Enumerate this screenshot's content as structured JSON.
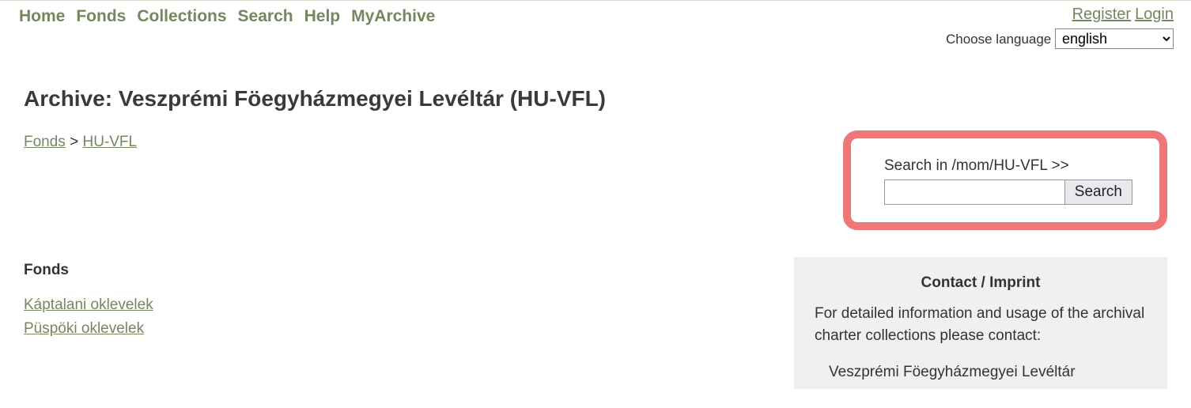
{
  "nav": {
    "items": [
      "Home",
      "Fonds",
      "Collections",
      "Search",
      "Help",
      "MyArchive"
    ],
    "register": "Register",
    "login": "Login",
    "choose_lang_label": "Choose language",
    "lang_selected": "english"
  },
  "main": {
    "title": "Archive: Veszprémi Föegyházmegyei Levéltár (HU-VFL)",
    "breadcrumb": {
      "fonds": "Fonds",
      "sep": ">",
      "code": "HU-VFL"
    },
    "fonds_heading": "Fonds",
    "fonds_links": [
      "Káptalani oklevelek",
      "Püspöki oklevelek"
    ]
  },
  "search": {
    "label": "Search in /mom/HU-VFL >>",
    "button": "Search"
  },
  "contact": {
    "heading": "Contact / Imprint",
    "body": "For detailed information and usage of the archival charter collections please contact:",
    "org": "Veszprémi Föegyházmegyei Levéltár"
  }
}
